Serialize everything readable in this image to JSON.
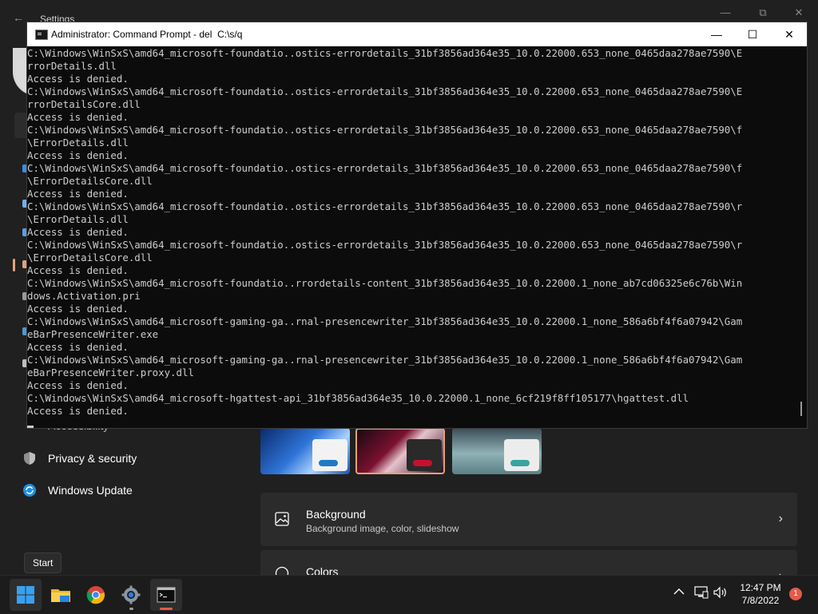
{
  "settings": {
    "title": "Settings",
    "back": "←",
    "nav_partial_label": "Accessibility",
    "nav_items": [
      {
        "label": "Privacy & security",
        "icon": "shield-icon"
      },
      {
        "label": "Windows Update",
        "icon": "windows-update-icon"
      }
    ],
    "themes": [
      {
        "name": "windows-light",
        "pill_color": "#1f7ac4"
      },
      {
        "name": "glow-dark",
        "pill_color": "#c8102e"
      },
      {
        "name": "captured-motion",
        "pill_color": "#3aa3a0"
      }
    ],
    "background_card": {
      "title": "Background",
      "subtitle": "Background image, color, slideshow",
      "icon": "picture-icon"
    },
    "colors_card": {
      "title": "Colors",
      "icon": "palette-icon"
    }
  },
  "cmd": {
    "title": "Administrator: Command Prompt - del  C:\\s/q",
    "minimize": "—",
    "maximize": "☐",
    "close": "✕",
    "lines": [
      "C:\\Windows\\WinSxS\\amd64_microsoft-foundatio..ostics-errordetails_31bf3856ad364e35_10.0.22000.653_none_0465daa278ae7590\\E",
      "rrorDetails.dll",
      "Access is denied.",
      "C:\\Windows\\WinSxS\\amd64_microsoft-foundatio..ostics-errordetails_31bf3856ad364e35_10.0.22000.653_none_0465daa278ae7590\\E",
      "rrorDetailsCore.dll",
      "Access is denied.",
      "C:\\Windows\\WinSxS\\amd64_microsoft-foundatio..ostics-errordetails_31bf3856ad364e35_10.0.22000.653_none_0465daa278ae7590\\f",
      "\\ErrorDetails.dll",
      "Access is denied.",
      "C:\\Windows\\WinSxS\\amd64_microsoft-foundatio..ostics-errordetails_31bf3856ad364e35_10.0.22000.653_none_0465daa278ae7590\\f",
      "\\ErrorDetailsCore.dll",
      "Access is denied.",
      "C:\\Windows\\WinSxS\\amd64_microsoft-foundatio..ostics-errordetails_31bf3856ad364e35_10.0.22000.653_none_0465daa278ae7590\\r",
      "\\ErrorDetails.dll",
      "Access is denied.",
      "C:\\Windows\\WinSxS\\amd64_microsoft-foundatio..ostics-errordetails_31bf3856ad364e35_10.0.22000.653_none_0465daa278ae7590\\r",
      "\\ErrorDetailsCore.dll",
      "Access is denied.",
      "C:\\Windows\\WinSxS\\amd64_microsoft-foundatio..rrordetails-content_31bf3856ad364e35_10.0.22000.1_none_ab7cd06325e6c76b\\Win",
      "dows.Activation.pri",
      "Access is denied.",
      "C:\\Windows\\WinSxS\\amd64_microsoft-gaming-ga..rnal-presencewriter_31bf3856ad364e35_10.0.22000.1_none_586a6bf4f6a07942\\Gam",
      "eBarPresenceWriter.exe",
      "Access is denied.",
      "C:\\Windows\\WinSxS\\amd64_microsoft-gaming-ga..rnal-presencewriter_31bf3856ad364e35_10.0.22000.1_none_586a6bf4f6a07942\\Gam",
      "eBarPresenceWriter.proxy.dll",
      "Access is denied.",
      "C:\\Windows\\WinSxS\\amd64_microsoft-hgattest-api_31bf3856ad364e35_10.0.22000.1_none_6cf219f8ff105177\\hgattest.dll",
      "Access is denied."
    ]
  },
  "taskbar": {
    "tooltip": "Start",
    "apps": [
      {
        "name": "start-button",
        "icon": "windows-logo-icon"
      },
      {
        "name": "file-explorer",
        "icon": "folder-icon"
      },
      {
        "name": "chrome",
        "icon": "chrome-icon"
      },
      {
        "name": "settings",
        "icon": "gear-icon"
      },
      {
        "name": "command-prompt",
        "icon": "terminal-icon"
      }
    ],
    "tray": {
      "chevron": "︿",
      "time": "12:47 PM",
      "date": "7/8/2022",
      "notification_count": "1"
    }
  },
  "colors": {
    "accent": "#e0a27c",
    "console_bg": "#0c0c0c",
    "console_fg": "#cccccc",
    "badge": "#e35a4a"
  }
}
